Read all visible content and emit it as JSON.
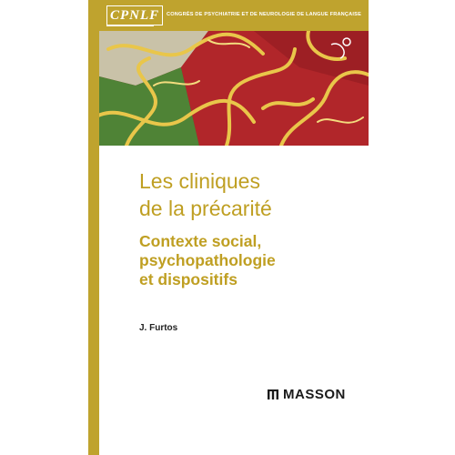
{
  "header": {
    "logo_text": "CPNLF",
    "congress_text": "CONGRÈS DE PSYCHIATRIE ET DE NEUROLOGIE DE LANGUE FRANÇAISE"
  },
  "title_lines": [
    "Les cliniques",
    "de la précarité"
  ],
  "subtitle_lines": [
    "Contexte social,",
    "psychopathologie",
    "et dispositifs"
  ],
  "author": "J. Furtos",
  "publisher": "MASSON",
  "colors": {
    "accent_gold": "#bfa32e",
    "title_gold": "#bf9f22",
    "art_red": "#b1262a",
    "art_green": "#5a8a3a",
    "art_yellow": "#e9c64a"
  }
}
